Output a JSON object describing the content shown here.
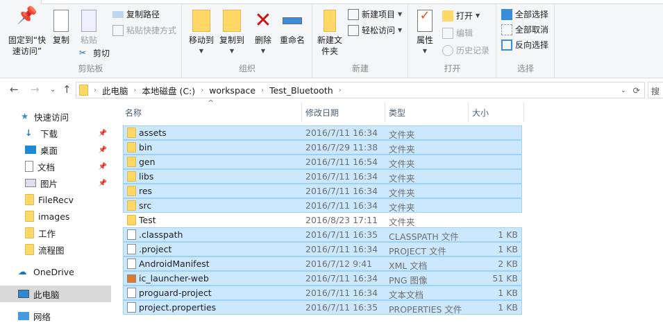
{
  "ribbon": {
    "clipboard": {
      "label": "剪贴板",
      "pin": "固定到“快速访问”",
      "copy": "复制",
      "paste": "粘贴",
      "copy_path": "复制路径",
      "paste_shortcut": "粘贴快捷方式",
      "cut": "剪切"
    },
    "organize": {
      "label": "组织",
      "move_to": "移动到",
      "copy_to": "复制到",
      "delete": "删除",
      "rename": "重命名"
    },
    "new": {
      "label": "新建",
      "new_folder": "新建文件夹",
      "new_item": "新建项目",
      "easy_access": "轻松访问"
    },
    "open": {
      "label": "打开",
      "properties": "属性",
      "open": "打开",
      "edit": "编辑",
      "history": "历史记录"
    },
    "select": {
      "label": "选择",
      "select_all": "全部选择",
      "select_none": "全部取消",
      "invert": "反向选择"
    }
  },
  "address": {
    "crumbs": [
      "此电脑",
      "本地磁盘 (C:)",
      "workspace",
      "Test_Bluetooth"
    ],
    "search_placeholder": "搜"
  },
  "nav": {
    "quick_access": "快速访问",
    "items": [
      "下载",
      "桌面",
      "文档",
      "图片",
      "FileRecv",
      "images",
      "工作",
      "流程图"
    ],
    "onedrive": "OneDrive",
    "this_pc": "此电脑",
    "network": "网络"
  },
  "columns": [
    "名称",
    "修改日期",
    "类型",
    "大小"
  ],
  "files": [
    {
      "name": "assets",
      "date": "2016/7/11 16:34",
      "type": "文件夹",
      "size": "",
      "kind": "folder",
      "selected": true
    },
    {
      "name": "bin",
      "date": "2016/7/29 11:38",
      "type": "文件夹",
      "size": "",
      "kind": "folder",
      "selected": true
    },
    {
      "name": "gen",
      "date": "2016/7/11 16:54",
      "type": "文件夹",
      "size": "",
      "kind": "folder",
      "selected": true
    },
    {
      "name": "libs",
      "date": "2016/7/11 16:34",
      "type": "文件夹",
      "size": "",
      "kind": "folder",
      "selected": true
    },
    {
      "name": "res",
      "date": "2016/7/11 16:34",
      "type": "文件夹",
      "size": "",
      "kind": "folder",
      "selected": true
    },
    {
      "name": "src",
      "date": "2016/7/11 16:34",
      "type": "文件夹",
      "size": "",
      "kind": "folder",
      "selected": true
    },
    {
      "name": "Test",
      "date": "2016/8/23 17:11",
      "type": "文件夹",
      "size": "",
      "kind": "folder",
      "selected": false
    },
    {
      "name": ".classpath",
      "date": "2016/7/11 16:35",
      "type": "CLASSPATH 文件",
      "size": "1 KB",
      "kind": "doc",
      "selected": true
    },
    {
      "name": ".project",
      "date": "2016/7/11 16:34",
      "type": "PROJECT 文件",
      "size": "1 KB",
      "kind": "doc",
      "selected": true
    },
    {
      "name": "AndroidManifest",
      "date": "2016/7/12 9:41",
      "type": "XML 文档",
      "size": "2 KB",
      "kind": "doc",
      "selected": true
    },
    {
      "name": "ic_launcher-web",
      "date": "2016/7/11 16:34",
      "type": "PNG 图像",
      "size": "51 KB",
      "kind": "png",
      "selected": true
    },
    {
      "name": "proguard-project",
      "date": "2016/7/11 16:34",
      "type": "文本文档",
      "size": "1 KB",
      "kind": "doc",
      "selected": true
    },
    {
      "name": "project.properties",
      "date": "2016/7/11 16:35",
      "type": "PROPERTIES 文件",
      "size": "1 KB",
      "kind": "doc",
      "selected": true
    }
  ]
}
